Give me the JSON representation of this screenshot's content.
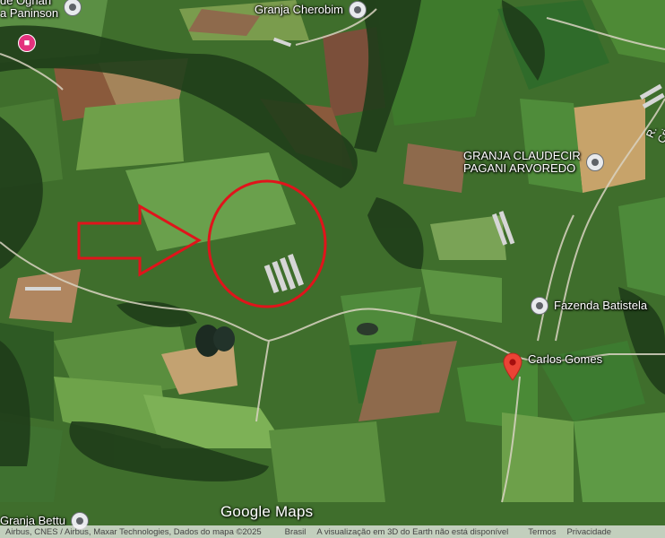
{
  "map": {
    "places": [
      {
        "id": "paninson",
        "line1": "de Ognan",
        "line2": "a Paninson",
        "icon": "location-icon"
      },
      {
        "id": "cherobim",
        "label": "Granja Cherobim",
        "icon": "location-icon"
      },
      {
        "id": "claudecir",
        "line1": "GRANJA CLAUDECIR",
        "line2": "PAGANI ARVOREDO",
        "icon": "location-icon"
      },
      {
        "id": "batistela",
        "label": "Fazenda Batistela",
        "icon": "location-icon"
      },
      {
        "id": "carlos",
        "label": "Carlos Gomes",
        "icon": "red-pin-icon"
      },
      {
        "id": "bettu",
        "label": "Granja Bettu",
        "icon": "location-icon"
      }
    ],
    "road_label": "R. Cri",
    "logo": "Google Maps",
    "attribution": {
      "credits": "Airbus, CNES / Airbus, Maxar Technologies, Dados do mapa ©2025",
      "country": "Brasil",
      "notice": "A visualização em 3D do Earth não está disponível",
      "terms": "Termos",
      "privacy": "Privacidade"
    },
    "overlay": {
      "circle_color": "#e0141b",
      "arrow_color": "#e0141b"
    }
  }
}
